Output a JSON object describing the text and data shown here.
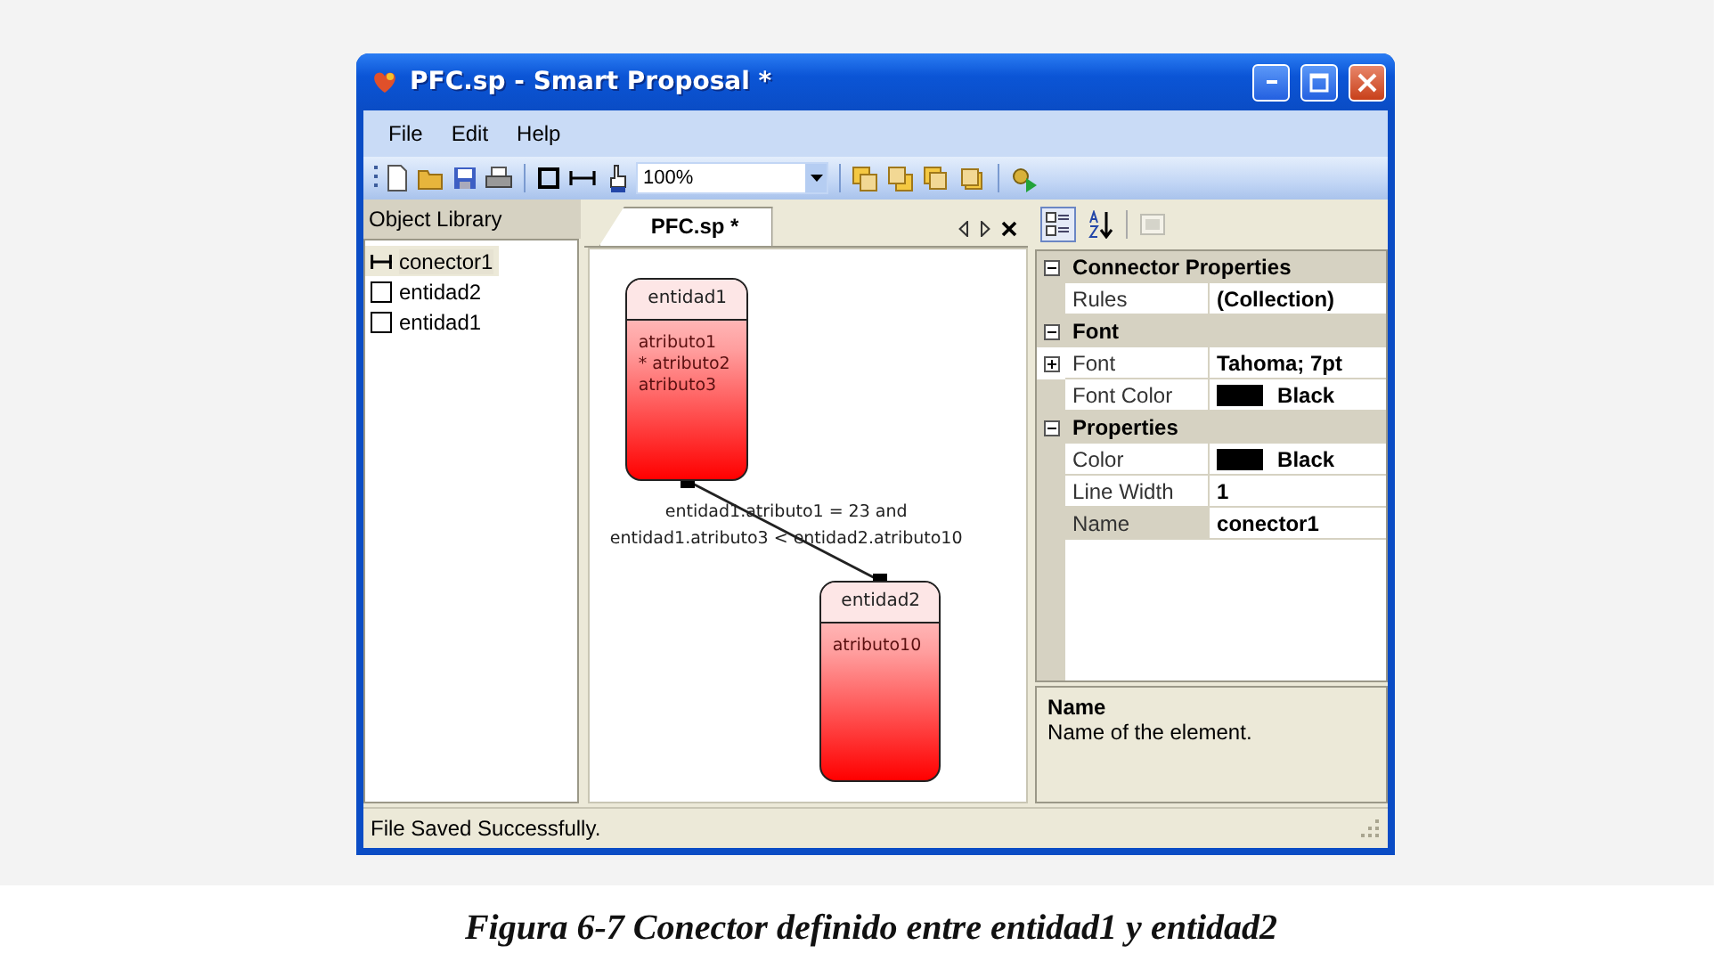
{
  "window": {
    "title": "PFC.sp - Smart Proposal *"
  },
  "menu": [
    {
      "label": "File"
    },
    {
      "label": "Edit"
    },
    {
      "label": "Help"
    }
  ],
  "toolbar": {
    "zoom": "100%"
  },
  "object_library": {
    "title": "Object Library",
    "items": [
      {
        "label": "conector1",
        "kind": "connector",
        "selected": true
      },
      {
        "label": "entidad2",
        "kind": "entity",
        "selected": false
      },
      {
        "label": "entidad1",
        "kind": "entity",
        "selected": false
      }
    ]
  },
  "document": {
    "tab": "PFC.sp *",
    "entities": [
      {
        "name": "entidad1",
        "attributes": [
          "atributo1",
          "* atributo2",
          "atributo3"
        ]
      },
      {
        "name": "entidad2",
        "attributes": [
          "atributo10"
        ]
      }
    ],
    "connector": {
      "label_lines": [
        "entidad1.atributo1 = 23 and",
        "entidad1.atributo3 < entidad2.atributo10"
      ]
    }
  },
  "properties": {
    "view_buttons": [
      {
        "kind": "categorized",
        "selected": true,
        "disabled": false
      },
      {
        "kind": "alphabetical",
        "selected": false,
        "disabled": false
      },
      {
        "kind": "pages",
        "selected": false,
        "disabled": true
      }
    ],
    "categories": [
      {
        "title": "Connector Properties",
        "expanded": true,
        "rows": [
          {
            "name": "Rules",
            "value": "(Collection)",
            "selected": false
          }
        ]
      },
      {
        "title": "Font",
        "expanded": true,
        "rows": [
          {
            "name": "Font",
            "value": "Tahoma; 7pt",
            "expanded": false,
            "selected": false
          },
          {
            "name": "Font Color",
            "value": "Black",
            "color": "#000000",
            "selected": false
          }
        ]
      },
      {
        "title": "Properties",
        "expanded": true,
        "rows": [
          {
            "name": "Color",
            "value": "Black",
            "color": "#000000",
            "selected": false
          },
          {
            "name": "Line Width",
            "value": "1",
            "selected": false
          },
          {
            "name": "Name",
            "value": "conector1",
            "selected": true
          }
        ]
      }
    ],
    "description": {
      "title": "Name",
      "text": "Name of the element."
    }
  },
  "status_bar": {
    "text": "File Saved Successfully."
  },
  "caption": "Figura 6-7 Conector definido entre entidad1 y entidad2"
}
